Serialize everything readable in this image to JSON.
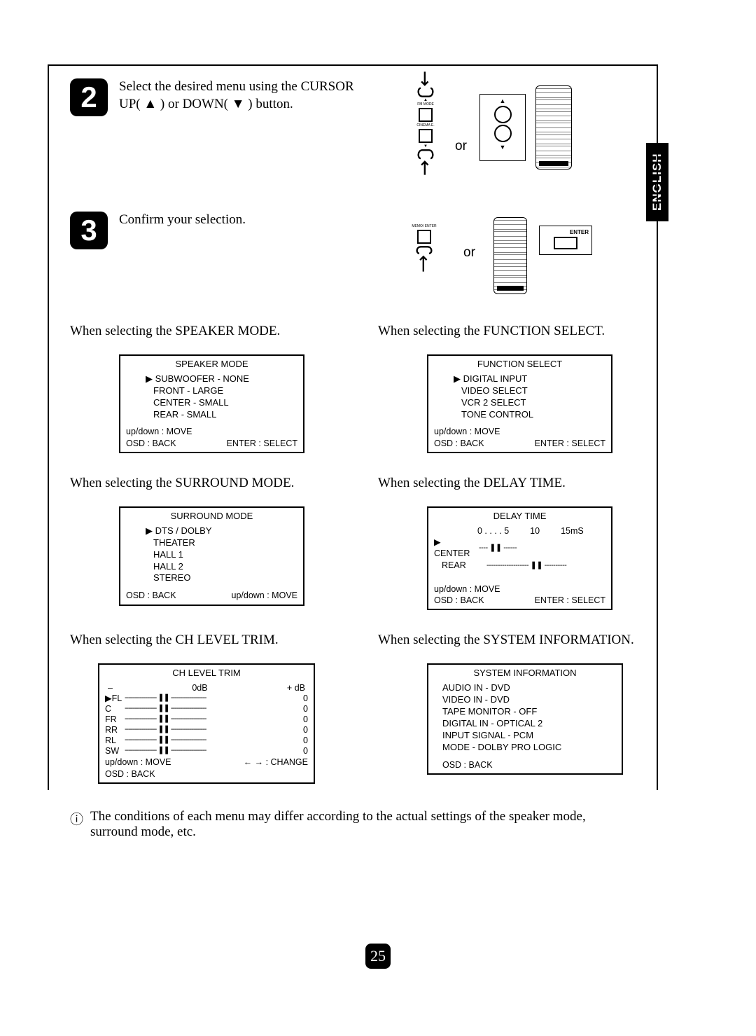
{
  "language_tab": "ENGLISH",
  "page_number": "25",
  "step2": {
    "number": "2",
    "text": "Select the desired menu using the CURSOR UP( ▲ ) or DOWN( ▼ ) button.",
    "or_label": "or",
    "panel_labels": {
      "top": "FM MODE",
      "bottom": "CINEMA E."
    }
  },
  "step3": {
    "number": "3",
    "text": "Confirm your selection.",
    "or_label": "or",
    "panel_label": "MEMO/ ENTER",
    "callout_label": "ENTER"
  },
  "sections": {
    "speaker_mode": {
      "heading": "When selecting the SPEAKER MODE.",
      "title": "SPEAKER MODE",
      "lines": [
        "▶ SUBWOOFER - NONE",
        "FRONT    - LARGE",
        "CENTER  - SMALL",
        "REAR       - SMALL"
      ],
      "footer_top": "up/down : MOVE",
      "footer_left": "OSD : BACK",
      "footer_right": "ENTER : SELECT"
    },
    "function_select": {
      "heading": "When selecting the FUNCTION SELECT.",
      "title": "FUNCTION SELECT",
      "lines": [
        "▶ DIGITAL INPUT",
        "VIDEO SELECT",
        "VCR 2 SELECT",
        "TONE CONTROL"
      ],
      "footer_top": "up/down : MOVE",
      "footer_left": "OSD : BACK",
      "footer_right": "ENTER : SELECT"
    },
    "surround_mode": {
      "heading": "When selecting the SURROUND MODE.",
      "title": "SURROUND MODE",
      "lines": [
        "▶ DTS / DOLBY",
        "THEATER",
        "HALL 1",
        "HALL 2",
        "STEREO"
      ],
      "footer_left": "OSD : BACK",
      "footer_right": "up/down : MOVE"
    },
    "delay_time": {
      "heading": "When selecting the DELAY TIME.",
      "title": "DELAY TIME",
      "scale": [
        "0 . . . . 5",
        "10",
        "15mS"
      ],
      "rows": [
        {
          "label": "▶ CENTER",
          "bar": "---- ❚❚ ------"
        },
        {
          "label": "REAR",
          "bar": "------------------- ❚❚ ----------"
        }
      ],
      "footer_top": "up/down : MOVE",
      "footer_left": "OSD : BACK",
      "footer_right": "ENTER : SELECT"
    },
    "ch_level_trim": {
      "heading": "When selecting the CH LEVEL TRIM.",
      "title": "CH LEVEL TRIM",
      "header_left": "–",
      "header_mid": "0dB",
      "header_right": "+ dB",
      "rows": [
        {
          "ch": "▶FL",
          "val": "0"
        },
        {
          "ch": "C",
          "val": "0"
        },
        {
          "ch": "FR",
          "val": "0"
        },
        {
          "ch": "RR",
          "val": "0"
        },
        {
          "ch": "RL",
          "val": "0"
        },
        {
          "ch": "SW",
          "val": "0"
        }
      ],
      "bar": "----------------- ❚❚ -------------------",
      "footer_left": "up/down : MOVE",
      "footer_right": "← → : CHANGE",
      "footer_bottom": "OSD : BACK"
    },
    "system_information": {
      "heading": "When selecting the SYSTEM INFORMATION.",
      "title": "SYSTEM INFORMATION",
      "lines": [
        "AUDIO IN - DVD",
        "VIDEO IN - DVD",
        "TAPE MONITOR - OFF",
        "DIGITAL IN - OPTICAL 2",
        "INPUT SIGNAL - PCM",
        "MODE - DOLBY PRO LOGIC"
      ],
      "footer": "OSD : BACK"
    }
  },
  "note": "The conditions of each menu may differ according to the actual settings of the speaker mode, surround mode, etc."
}
